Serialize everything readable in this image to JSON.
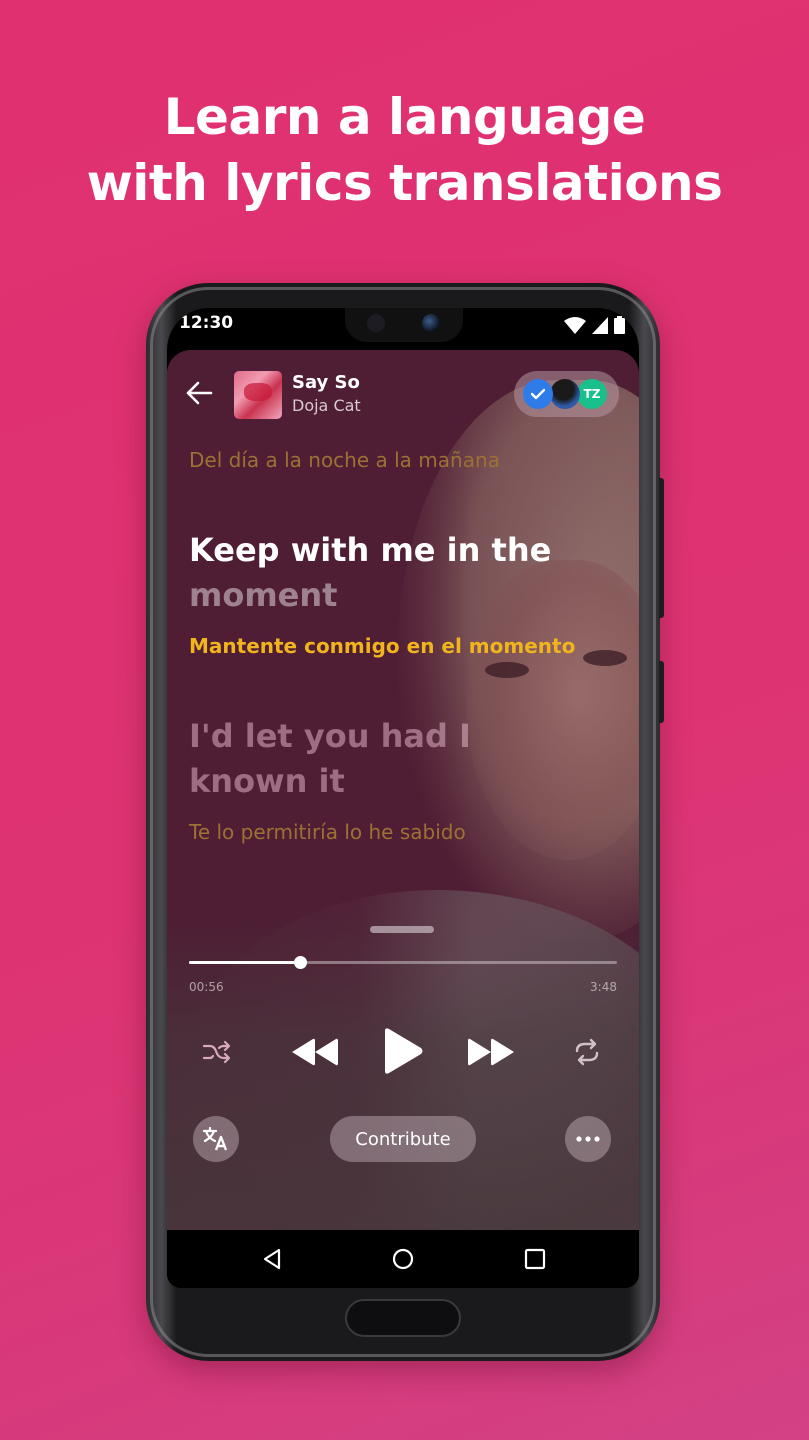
{
  "headline": {
    "line1": "Learn a language",
    "line2": "with lyrics translations"
  },
  "status_bar": {
    "time": "12:30",
    "icons": [
      "wifi-icon",
      "signal-icon",
      "battery-icon"
    ]
  },
  "player": {
    "header": {
      "back_icon": "arrow-left-icon",
      "track_title": "Say So",
      "artist": "Doja Cat",
      "contributors": [
        {
          "type": "verified",
          "icon": "checkmark-icon",
          "color": "#2f7be8"
        },
        {
          "type": "photo"
        },
        {
          "type": "initials",
          "text": "TZ",
          "color": "#19c08c"
        }
      ]
    },
    "lyrics": [
      {
        "state": "previous",
        "translation": "Del día a la noche a la mañana"
      },
      {
        "state": "active",
        "sung": "Keep with me in the",
        "unsung": "moment",
        "translation": "Mantente conmigo en el momento"
      },
      {
        "state": "next",
        "original": "I'd let you had I known it",
        "original_line1": "I'd let you had I",
        "original_line2": "known it",
        "translation": "Te lo permitiría lo he sabido"
      }
    ],
    "progress": {
      "elapsed": "00:56",
      "total": "3:48",
      "fraction": 0.26
    },
    "controls": {
      "shuffle_icon": "shuffle-icon",
      "previous_icon": "rewind-icon",
      "play_icon": "play-icon",
      "next_icon": "fast-forward-icon",
      "repeat_icon": "repeat-icon"
    },
    "actions": {
      "translate_icon": "translate-icon",
      "contribute_label": "Contribute",
      "more_icon": "more-horizontal-icon"
    }
  },
  "nav_bar": {
    "back_icon": "nav-back-icon",
    "home_icon": "nav-home-icon",
    "recents_icon": "nav-recents-icon"
  },
  "colors": {
    "background": "#de3373",
    "player_bg": "#4f1d34",
    "translation_active": "#f0b41e",
    "translation_dim": "#9c7134",
    "verified_blue": "#2f7be8",
    "initials_green": "#19c08c"
  }
}
